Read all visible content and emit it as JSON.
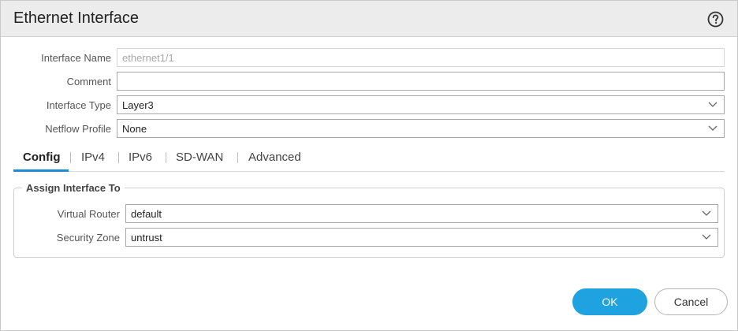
{
  "dialog": {
    "title": "Ethernet Interface",
    "help_icon": "question-circle-icon"
  },
  "form": {
    "interface_name": {
      "label": "Interface Name",
      "value": "ethernet1/1"
    },
    "comment": {
      "label": "Comment",
      "value": ""
    },
    "interface_type": {
      "label": "Interface Type",
      "value": "Layer3"
    },
    "netflow_profile": {
      "label": "Netflow Profile",
      "value": "None"
    }
  },
  "tabs": [
    {
      "label": "Config",
      "active": true
    },
    {
      "label": "IPv4"
    },
    {
      "label": "IPv6"
    },
    {
      "label": "SD-WAN"
    },
    {
      "label": "Advanced"
    }
  ],
  "assign": {
    "legend": "Assign Interface To",
    "virtual_router": {
      "label": "Virtual Router",
      "value": "default"
    },
    "security_zone": {
      "label": "Security Zone",
      "value": "untrust"
    }
  },
  "buttons": {
    "ok": "OK",
    "cancel": "Cancel"
  },
  "colors": {
    "accent": "#1ea2e0",
    "tab_underline": "#1a8dd4",
    "header_bg": "#ececec"
  }
}
